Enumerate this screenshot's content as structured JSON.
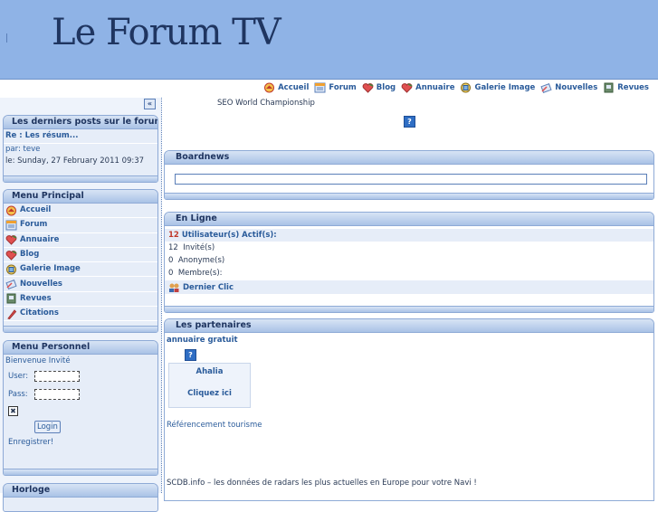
{
  "site": {
    "title": "Le Forum TV"
  },
  "topnav": {
    "items": [
      {
        "label": "Accueil",
        "icon": "home-icon"
      },
      {
        "label": "Forum",
        "icon": "forum-icon"
      },
      {
        "label": "Blog",
        "icon": "heart-icon"
      },
      {
        "label": "Annuaire",
        "icon": "heart-icon"
      },
      {
        "label": "Galerie Image",
        "icon": "gallery-icon"
      },
      {
        "label": "Nouvelles",
        "icon": "news-icon"
      },
      {
        "label": "Revues",
        "icon": "book-icon"
      }
    ]
  },
  "sidebar": {
    "collapse_label": "«",
    "latest_posts": {
      "title": "Les derniers posts sur le forum",
      "post_title": "Re : Les résum...",
      "author_line": "par: teve",
      "date_line": "le: Sunday, 27 February 2011 09:37"
    },
    "main_menu": {
      "title": "Menu Principal",
      "items": [
        {
          "label": "Accueil",
          "icon": "home-icon"
        },
        {
          "label": "Forum",
          "icon": "forum-icon"
        },
        {
          "label": "Annuaire",
          "icon": "heart-icon"
        },
        {
          "label": "Blog",
          "icon": "heart-icon"
        },
        {
          "label": "Galerie Image",
          "icon": "gallery-icon"
        },
        {
          "label": "Nouvelles",
          "icon": "news-icon"
        },
        {
          "label": "Revues",
          "icon": "book-icon"
        },
        {
          "label": "Citations",
          "icon": "pen-icon"
        }
      ]
    },
    "personal_menu": {
      "title": "Menu Personnel",
      "welcome": "Bienvenue Invité",
      "user_label": "User:",
      "pass_label": "Pass:",
      "checkbox_mark": "✖",
      "login_label": "Login",
      "register_label": "Enregistrer!"
    },
    "clock": {
      "title": "Horloge"
    }
  },
  "main": {
    "top_link": "SEO World Championship",
    "help_glyph": "?",
    "boardnews": {
      "title": "Boardnews"
    },
    "online": {
      "title": "En Ligne",
      "active_count": "12",
      "active_label": "Utilisateur(s) Actif(s):",
      "guests_count": "12",
      "guests_label": "Invité(s)",
      "anon_count": "0",
      "anon_label": "Anonyme(s)",
      "members_count": "0",
      "members_label": "Membre(s):",
      "last_click": "Dernier Clic"
    },
    "partners": {
      "title": "Les partenaires",
      "annuaire": "annuaire gratuit",
      "ahalia": "Ahalia",
      "cliquez": "Cliquez ici",
      "tourisme": "Référencement tourisme",
      "scdb": "SCDB.info – les données de radars les plus actuelles en Europe pour votre Navi !"
    }
  }
}
